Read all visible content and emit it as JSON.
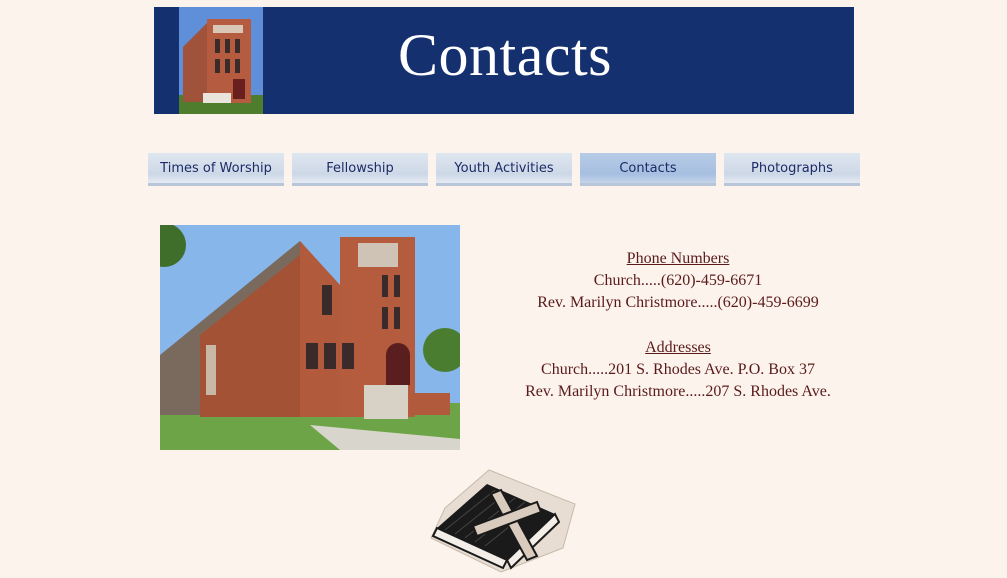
{
  "header": {
    "title": "Contacts"
  },
  "nav": {
    "items": [
      {
        "label": "Times of Worship"
      },
      {
        "label": "Fellowship"
      },
      {
        "label": "Youth Activities"
      },
      {
        "label": "Contacts"
      },
      {
        "label": "Photographs"
      }
    ],
    "active": "Contacts"
  },
  "contact": {
    "phone_heading": "Phone Numbers",
    "phones": [
      "Church.....(620)-459-6671",
      "Rev. Marilyn Christmore.....(620)-459-6699"
    ],
    "address_heading": "Addresses",
    "addresses": [
      "Church.....201 S. Rhodes Ave.  P.O. Box 37",
      "Rev. Marilyn Christmore.....207 S. Rhodes Ave."
    ]
  },
  "colors": {
    "banner": "#14306e",
    "background": "#fbf3ec",
    "text": "#5a1a1a",
    "nav_text": "#1d2b66"
  }
}
